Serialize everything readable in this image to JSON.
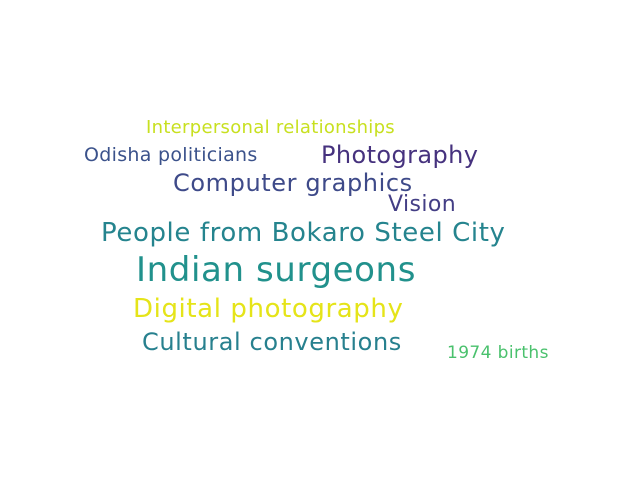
{
  "word_cloud": {
    "words": [
      {
        "text": "Interpersonal relationships",
        "color": "#c8e020"
      },
      {
        "text": "Odisha politicians",
        "color": "#3b528b"
      },
      {
        "text": "Photography",
        "color": "#46327e"
      },
      {
        "text": "Computer graphics",
        "color": "#3e4a89"
      },
      {
        "text": "Vision",
        "color": "#433e85"
      },
      {
        "text": "People from Bokaro Steel City",
        "color": "#25848e"
      },
      {
        "text": "Indian surgeons",
        "color": "#21918c"
      },
      {
        "text": "Digital photography",
        "color": "#e5e419"
      },
      {
        "text": "Cultural conventions",
        "color": "#27808e"
      },
      {
        "text": "1974 births",
        "color": "#4ac16d"
      }
    ]
  }
}
